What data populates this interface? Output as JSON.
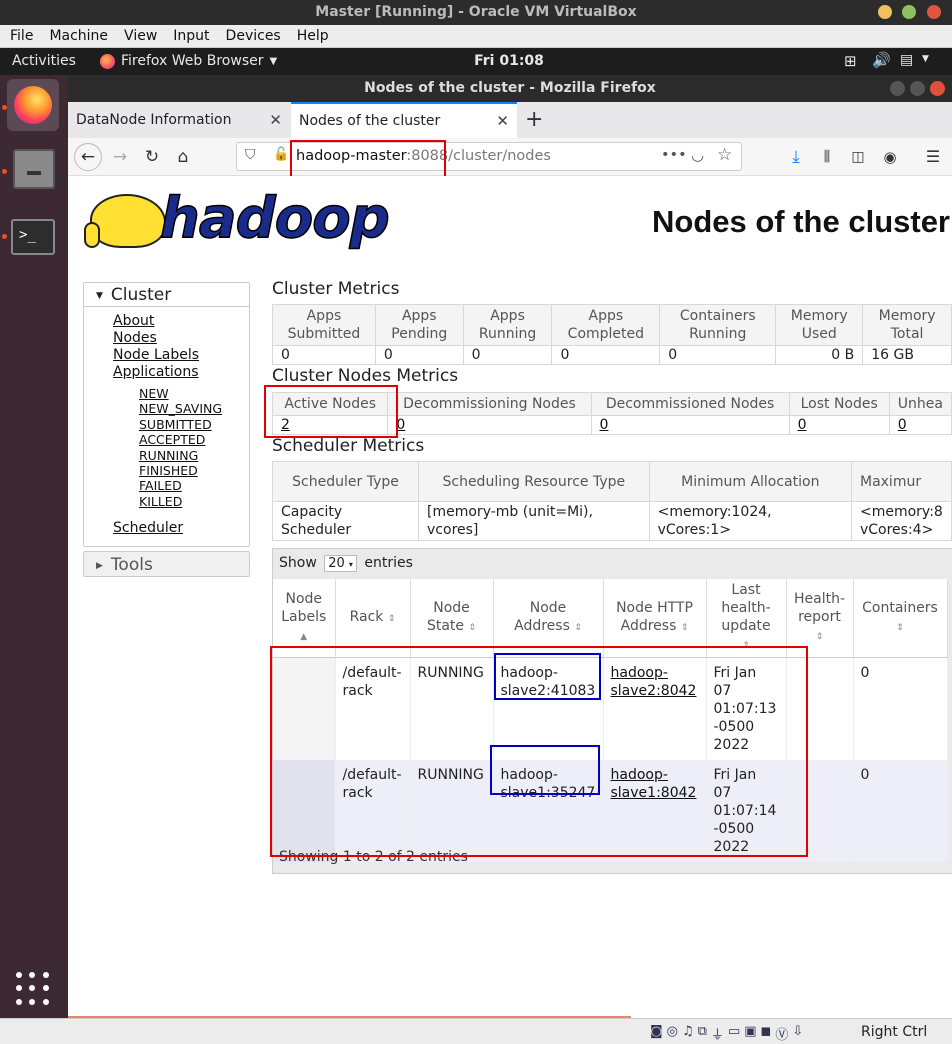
{
  "vbox": {
    "title": "Master [Running] - Oracle VM VirtualBox",
    "menu": [
      "File",
      "Machine",
      "View",
      "Input",
      "Devices",
      "Help"
    ],
    "host_key": "Right Ctrl"
  },
  "gnome": {
    "activities": "Activities",
    "app_name": "Firefox Web Browser",
    "clock": "Fri 01:08"
  },
  "firefox": {
    "window_title": "Nodes of the cluster - Mozilla Firefox",
    "tabs": [
      {
        "label": "DataNode Information"
      },
      {
        "label": "Nodes of the cluster"
      }
    ],
    "url_host": "hadoop-master",
    "url_rest": ":8088/cluster/nodes",
    "url_more": "•••"
  },
  "page": {
    "logo_text": "hadoop",
    "title": "Nodes of the cluster",
    "sidebar": {
      "cluster_label": "Cluster",
      "links": [
        "About",
        "Nodes",
        "Node Labels",
        "Applications"
      ],
      "app_states": [
        "NEW",
        "NEW_SAVING",
        "SUBMITTED",
        "ACCEPTED",
        "RUNNING",
        "FINISHED",
        "FAILED",
        "KILLED"
      ],
      "scheduler": "Scheduler",
      "tools_label": "Tools"
    },
    "cluster_metrics": {
      "title": "Cluster Metrics",
      "headers": [
        [
          "Apps",
          "Submitted"
        ],
        [
          "Apps",
          "Pending"
        ],
        [
          "Apps",
          "Running"
        ],
        [
          "Apps",
          "Completed"
        ],
        [
          "Containers",
          "Running"
        ],
        [
          "Memory",
          "Used"
        ],
        [
          "Memory",
          "Total"
        ]
      ],
      "values": [
        "0",
        "0",
        "0",
        "0",
        "0",
        "0 B",
        "16 GB"
      ]
    },
    "node_metrics": {
      "title": "Cluster Nodes Metrics",
      "headers": [
        "Active Nodes",
        "Decommissioning Nodes",
        "Decommissioned Nodes",
        "Lost Nodes",
        "Unhea"
      ],
      "values": [
        "2",
        "0",
        "0",
        "0",
        "0"
      ]
    },
    "scheduler_metrics": {
      "title": "Scheduler Metrics",
      "headers": [
        "Scheduler Type",
        "Scheduling Resource Type",
        "Minimum Allocation",
        "Maximur"
      ],
      "values": [
        [
          "Capacity",
          "Scheduler"
        ],
        [
          "[memory-mb (unit=Mi),",
          "vcores]"
        ],
        [
          "<memory:1024,",
          "vCores:1>"
        ],
        [
          "<memory:8",
          "vCores:4>"
        ]
      ]
    },
    "nodes_table": {
      "show_label": "Show",
      "page_size": "20",
      "entries_label": "entries",
      "headers": [
        [
          "Node",
          "Labels"
        ],
        [
          "Rack"
        ],
        [
          "Node",
          "State"
        ],
        [
          "Node",
          "Address"
        ],
        [
          "Node HTTP",
          "Address"
        ],
        [
          "Last",
          "health-",
          "update"
        ],
        [
          "Health-",
          "report"
        ],
        [
          "Containers"
        ]
      ],
      "rows": [
        {
          "labels": "",
          "rack": [
            "/default-",
            "rack"
          ],
          "state": "RUNNING",
          "address": [
            "hadoop-",
            "slave2:41083"
          ],
          "http": [
            "hadoop-",
            "slave2:8042"
          ],
          "last_update": [
            "Fri Jan",
            "07",
            "01:07:13",
            "-0500",
            "2022"
          ],
          "health": "",
          "containers": "0"
        },
        {
          "labels": "",
          "rack": [
            "/default-",
            "rack"
          ],
          "state": "RUNNING",
          "address": [
            "hadoop-",
            "slave1:35247"
          ],
          "http": [
            "hadoop-",
            "slave1:8042"
          ],
          "last_update": [
            "Fri Jan",
            "07",
            "01:07:14",
            "-0500",
            "2022"
          ],
          "health": "",
          "containers": "0"
        }
      ],
      "footer": "Showing 1 to 2 of 2 entries"
    }
  }
}
